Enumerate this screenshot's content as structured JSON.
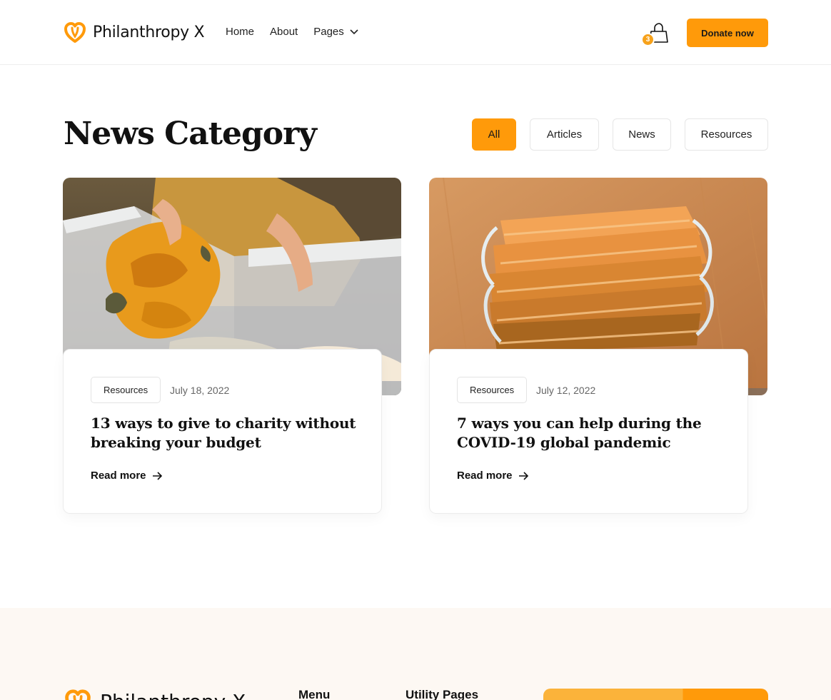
{
  "header": {
    "brand": "Philanthropy X",
    "nav": [
      "Home",
      "About",
      "Pages"
    ],
    "cart_count": "3",
    "donate_label": "Donate now"
  },
  "main": {
    "title": "News Category",
    "filters": [
      "All",
      "Articles",
      "News",
      "Resources"
    ],
    "active_filter": "All",
    "cards": [
      {
        "tag": "Resources",
        "date": "July 18, 2022",
        "title": "13 ways to give to charity without breaking your budget",
        "read_more": "Read more",
        "image": "hands sorting orange clothes in plastic bin"
      },
      {
        "tag": "Resources",
        "date": "July 12, 2022",
        "title": "7 ways you can help during the COVID-19 global pandemic",
        "read_more": "Read more",
        "image": "stack of orange fabric face masks on wooden table"
      }
    ]
  },
  "footer": {
    "brand": "Philanthropy X",
    "columns": [
      "Menu",
      "Utility Pages"
    ]
  },
  "colors": {
    "accent": "#ff9a0a",
    "footer_bg": "#fdf8f3"
  }
}
